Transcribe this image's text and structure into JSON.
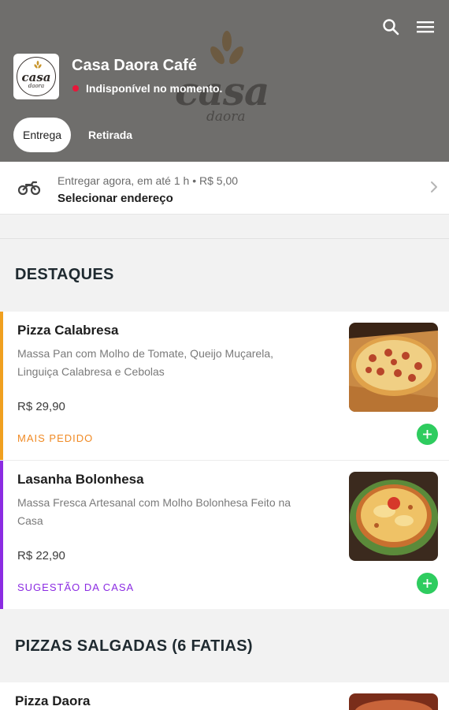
{
  "header": {
    "background_logo": {
      "word": "casa",
      "sub": "daora"
    },
    "store_logo": {
      "word": "casa",
      "sub": "daora"
    },
    "store_name": "Casa Daora Café",
    "status": {
      "text": "Indisponível no momento.",
      "color": "#e8173a"
    },
    "icons": [
      "search-icon",
      "menu-icon"
    ],
    "tabs": [
      {
        "label": "Entrega",
        "active": true
      },
      {
        "label": "Retirada",
        "active": false
      }
    ]
  },
  "delivery": {
    "icon": "motorcycle-icon",
    "line1": "Entregar agora, em até 1 h  •  R$ 5,00",
    "line2": "Selecionar endereço"
  },
  "sections": [
    {
      "title": "DESTAQUES",
      "items": [
        {
          "name": "Pizza Calabresa",
          "description": "Massa Pan com Molho de Tomate, Queijo Muçarela, Linguiça Calabresa e Cebolas",
          "price": "R$ 29,90",
          "tag": "MAIS PEDIDO",
          "tag_color": "#f08a24"
        },
        {
          "name": "Lasanha Bolonhesa",
          "description": "Massa Fresca Artesanal com Molho Bolonhesa Feito na Casa",
          "price": "R$ 22,90",
          "tag": "SUGESTÃO DA CASA",
          "tag_color": "#8b2be2"
        }
      ]
    },
    {
      "title": "PIZZAS SALGADAS (6 FATIAS)",
      "items": [
        {
          "name": "Pizza Daora"
        }
      ]
    }
  ],
  "colors": {
    "header_bg": "#6f6e6c",
    "add_button": "#2ecc5f"
  }
}
